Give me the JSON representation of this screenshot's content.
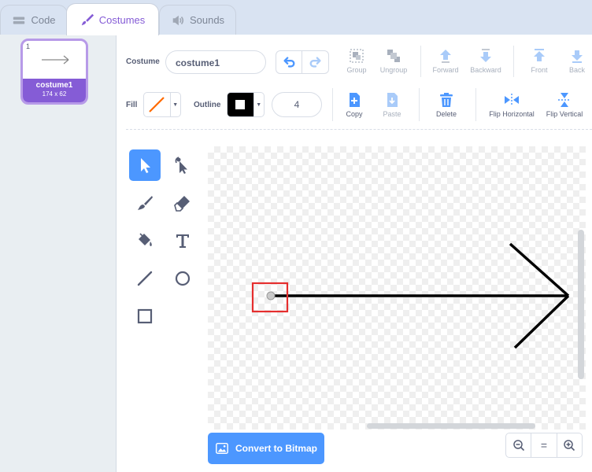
{
  "tabs": {
    "code": "Code",
    "costumes": "Costumes",
    "sounds": "Sounds"
  },
  "costume_list": [
    {
      "index": "1",
      "name": "costume1",
      "size": "174 x 62"
    }
  ],
  "toolbar": {
    "costume_label": "Costume",
    "costume_name": "costume1",
    "fill_label": "Fill",
    "outline_label": "Outline",
    "outline_width": "4",
    "group": "Group",
    "ungroup": "Ungroup",
    "forward": "Forward",
    "backward": "Backward",
    "front": "Front",
    "back": "Back",
    "copy": "Copy",
    "paste": "Paste",
    "delete": "Delete",
    "flip_horizontal": "Flip Horizontal",
    "flip_vertical": "Flip Vertical"
  },
  "colors": {
    "accent": "#855cd6",
    "primary": "#4c97ff",
    "fill_slash": "#ff6a00",
    "selection_box": "#e52e2e"
  },
  "tools": [
    "select-icon",
    "reshape-icon",
    "brush-icon",
    "eraser-icon",
    "fill-icon",
    "text-icon",
    "line-icon",
    "circle-icon",
    "rectangle-icon"
  ],
  "convert_button": "Convert to Bitmap",
  "zoom": {
    "out": "zoom-out-icon",
    "reset": "=",
    "in": "zoom-in-icon"
  }
}
